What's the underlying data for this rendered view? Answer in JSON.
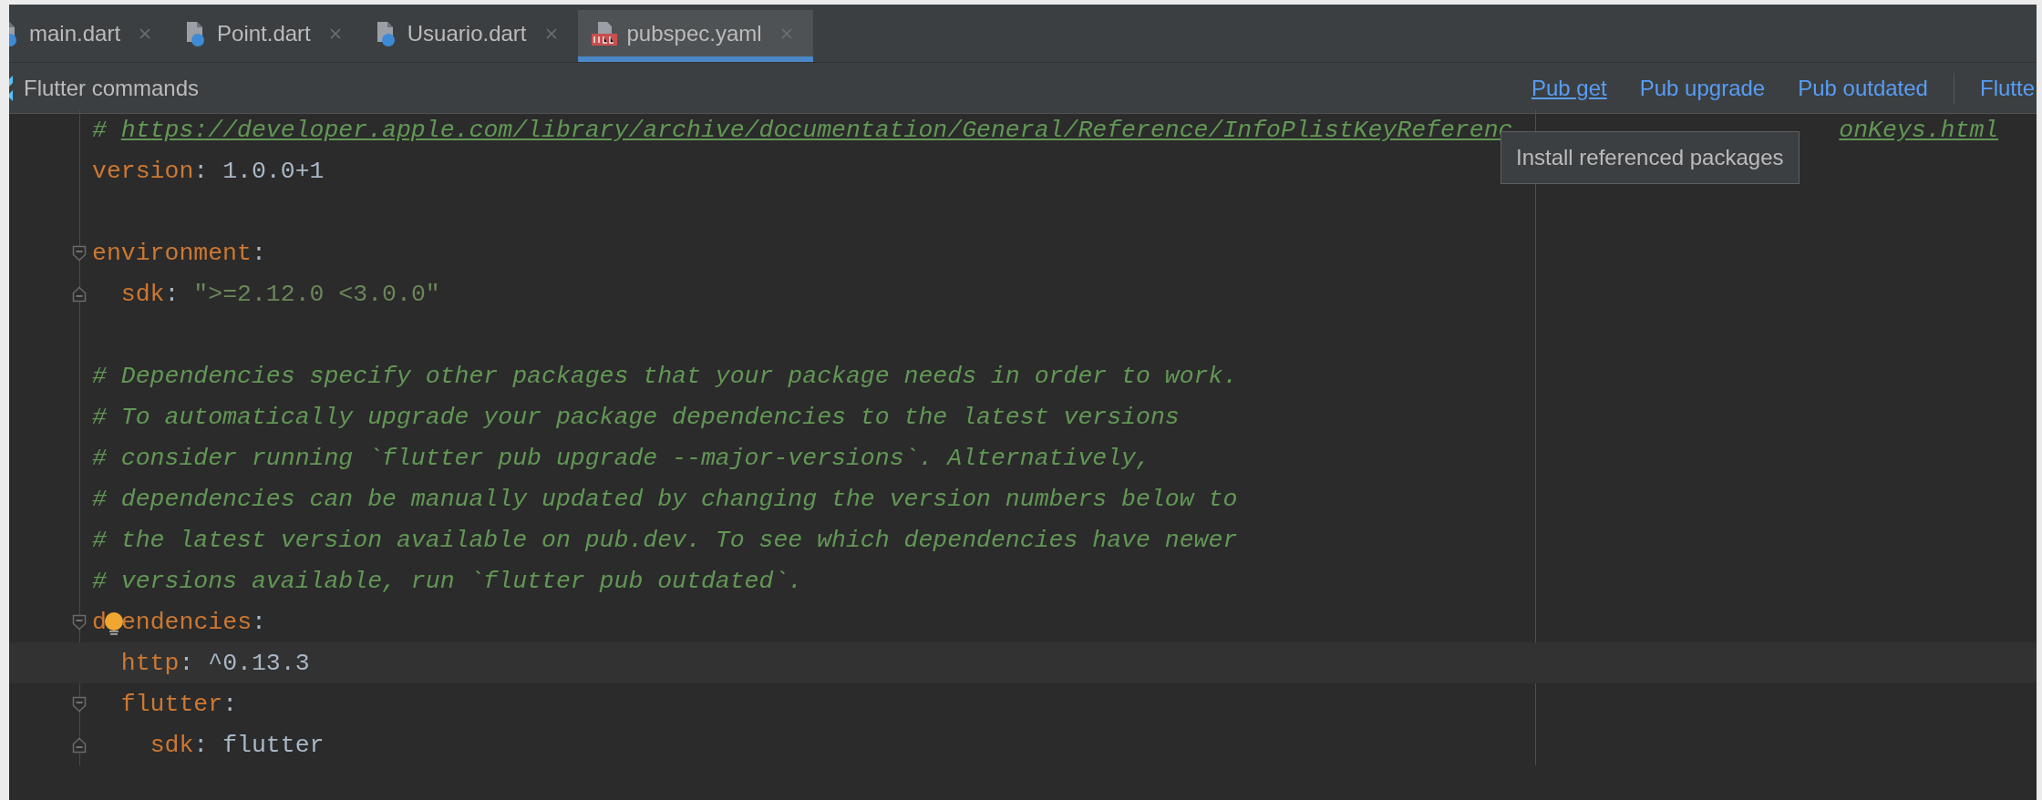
{
  "tabs": [
    {
      "label": "main.dart",
      "kind": "dart",
      "selected": false
    },
    {
      "label": "Point.dart",
      "kind": "dart",
      "selected": false
    },
    {
      "label": "Usuario.dart",
      "kind": "dart",
      "selected": false
    },
    {
      "label": "pubspec.yaml",
      "kind": "yaml",
      "selected": true
    }
  ],
  "commands_bar": {
    "title": "Flutter commands",
    "links": [
      {
        "label": "Pub get",
        "hovered": true
      },
      {
        "label": "Pub upgrade",
        "hovered": false
      },
      {
        "label": "Pub outdated",
        "hovered": false
      }
    ],
    "cut_link": "Flutte"
  },
  "tooltip": "Install referenced packages",
  "editor": {
    "lines": [
      {
        "kind": "url_comment",
        "prefix": "#",
        "parts": [
          "https://developer.apple.com/library/archive/documentation/General/Reference/InfoPlistKeyReferenc",
          "onKeys.html"
        ]
      },
      {
        "kind": "key_value",
        "key_parts": [
          "version"
        ],
        "sep": ":",
        "value": "1.0.0+1",
        "current": false,
        "fold_end": false,
        "bulb": false
      },
      {
        "kind": "blank"
      },
      {
        "kind": "key",
        "key_parts": [
          "environment"
        ],
        "sep": ":",
        "current": false,
        "fold_end": false,
        "bulb": false,
        "children": [
          {
            "kind": "key_string",
            "key_parts": [
              "sdk"
            ],
            "sep": ":",
            "value": "\">=2.12.0 <3.0.0\"",
            "current": false,
            "fold_end": true,
            "bulb": false
          }
        ]
      },
      {
        "kind": "blank"
      },
      {
        "kind": "comment",
        "text": "# Dependencies specify other packages that your package needs in order to work."
      },
      {
        "kind": "comment",
        "text": "# To automatically upgrade your package dependencies to the latest versions"
      },
      {
        "kind": "comment",
        "text": "# consider running `flutter pub upgrade --major-versions`. Alternatively,"
      },
      {
        "kind": "comment",
        "text": "# dependencies can be manually updated by changing the version numbers below to"
      },
      {
        "kind": "comment",
        "text": "# the latest version available on pub.dev. To see which dependencies have newer"
      },
      {
        "kind": "comment",
        "text": "# versions available, run `flutter pub outdated`."
      },
      {
        "kind": "key",
        "key_parts": [
          "d",
          "endencies"
        ],
        "sep": ":",
        "current": false,
        "fold_end": false,
        "bulb": true,
        "children": [
          {
            "kind": "key_value",
            "key_parts": [
              "http"
            ],
            "sep": ":",
            "value": "^0.13.3",
            "current": true,
            "fold_end": false,
            "bulb": false
          },
          {
            "kind": "key",
            "key_parts": [
              "flutter"
            ],
            "sep": ":",
            "current": false,
            "fold_end": false,
            "bulb": false,
            "children": [
              {
                "kind": "key_value",
                "key_parts": [
                  "sdk"
                ],
                "sep": ":",
                "value": "flutter",
                "current": false,
                "fold_end": true,
                "bulb": false
              }
            ]
          }
        ]
      }
    ]
  }
}
